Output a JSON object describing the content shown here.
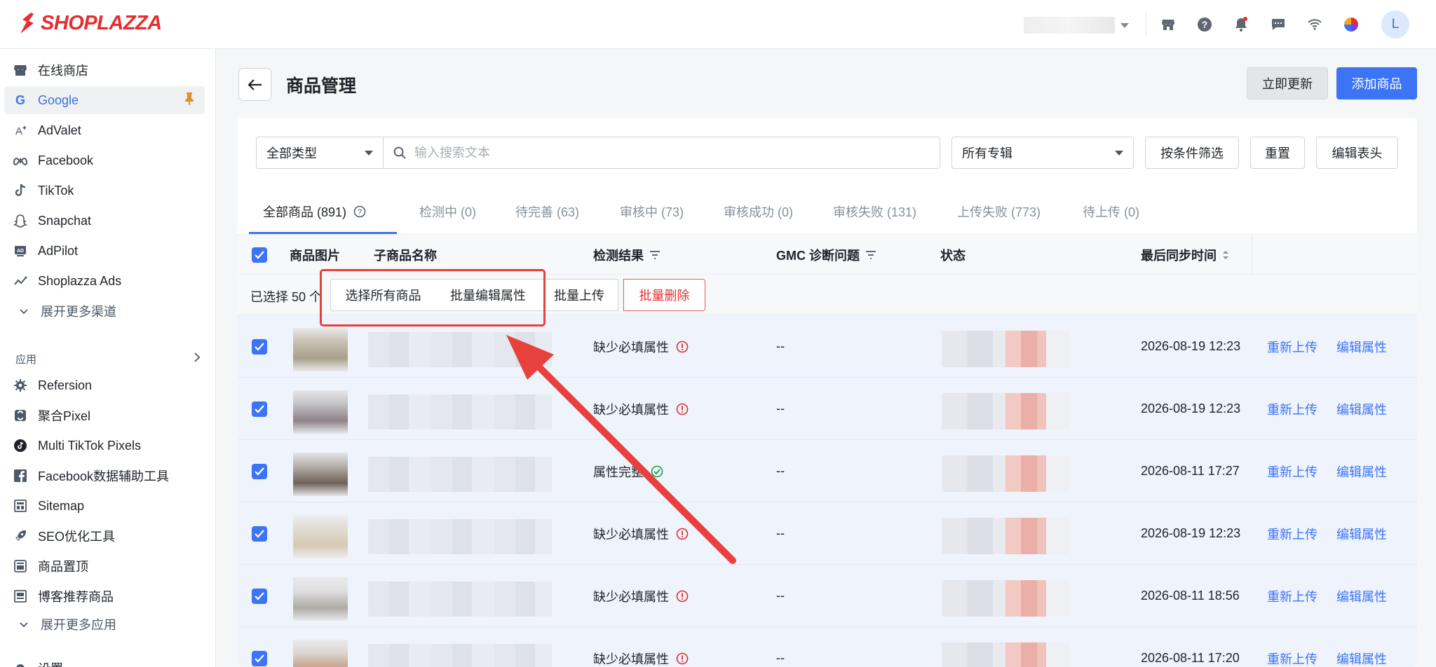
{
  "brand": {
    "name": "SHOPLAZZA",
    "color": "#e62d2f"
  },
  "topbar": {
    "icons": [
      "store-icon",
      "help-icon",
      "bell-icon",
      "chat-icon",
      "wifi-icon",
      "color-wheel-icon"
    ],
    "avatar_letter": "L"
  },
  "sidebar": {
    "channels": [
      {
        "label": "在线商店",
        "icon": "store-icon"
      },
      {
        "label": "Google",
        "icon": "google-icon",
        "active": true,
        "pinned": true
      },
      {
        "label": "AdValet",
        "icon": "advalet-icon"
      },
      {
        "label": "Facebook",
        "icon": "meta-icon"
      },
      {
        "label": "TikTok",
        "icon": "tiktok-icon"
      },
      {
        "label": "Snapchat",
        "icon": "snapchat-icon"
      },
      {
        "label": "AdPilot",
        "icon": "adpilot-icon"
      },
      {
        "label": "Shoplazza Ads",
        "icon": "shoplazza-ads-icon"
      }
    ],
    "expand_channels": "展开更多渠道",
    "apps_section": "应用",
    "apps": [
      {
        "label": "Refersion",
        "icon": "refersion-icon"
      },
      {
        "label": "聚合Pixel",
        "icon": "pixel-icon"
      },
      {
        "label": "Multi TikTok Pixels",
        "icon": "tiktok-icon"
      },
      {
        "label": "Facebook数据辅助工具",
        "icon": "facebook-icon"
      },
      {
        "label": "Sitemap",
        "icon": "sitemap-icon"
      },
      {
        "label": "SEO优化工具",
        "icon": "rocket-icon"
      },
      {
        "label": "商品置顶",
        "icon": "pin-top-icon"
      },
      {
        "label": "博客推荐商品",
        "icon": "blog-icon"
      }
    ],
    "expand_apps": "展开更多应用",
    "settings": "设置"
  },
  "header": {
    "title": "商品管理",
    "update_button": "立即更新",
    "add_button": "添加商品"
  },
  "filters": {
    "type_select": "全部类型",
    "search_placeholder": "输入搜索文本",
    "collection_select": "所有专辑",
    "condition_button": "按条件筛选",
    "reset_button": "重置",
    "edit_header_button": "编辑表头"
  },
  "tabs": [
    {
      "label": "全部商品 (891)",
      "active": true
    },
    {
      "label": "检测中 (0)"
    },
    {
      "label": "待完善 (63)"
    },
    {
      "label": "审核中 (73)"
    },
    {
      "label": "审核成功 (0)"
    },
    {
      "label": "审核失败 (131)"
    },
    {
      "label": "上传失败 (773)"
    },
    {
      "label": "待上传 (0)"
    }
  ],
  "table": {
    "columns": {
      "image": "商品图片",
      "name": "子商品名称",
      "result": "检测结果",
      "gmc": "GMC 诊断问题",
      "status": "状态",
      "last_sync": "最后同步时间"
    },
    "bulk": {
      "selected_label": "已选择 50 个",
      "select_all": "选择所有商品",
      "batch_edit": "批量编辑属性",
      "batch_upload": "批量上传",
      "batch_delete": "批量删除"
    },
    "rows": [
      {
        "result": "缺少必填属性",
        "result_type": "error",
        "gmc": "--",
        "last_sync": "2026-08-19 12:23",
        "action1": "重新上传",
        "action2": "编辑属性"
      },
      {
        "result": "缺少必填属性",
        "result_type": "error",
        "gmc": "--",
        "last_sync": "2026-08-19 12:23",
        "action1": "重新上传",
        "action2": "编辑属性"
      },
      {
        "result": "属性完整",
        "result_type": "ok",
        "gmc": "--",
        "last_sync": "2026-08-11 17:27",
        "action1": "重新上传",
        "action2": "编辑属性"
      },
      {
        "result": "缺少必填属性",
        "result_type": "error",
        "gmc": "--",
        "last_sync": "2026-08-19 12:23",
        "action1": "重新上传",
        "action2": "编辑属性"
      },
      {
        "result": "缺少必填属性",
        "result_type": "error",
        "gmc": "--",
        "last_sync": "2026-08-11 18:56",
        "action1": "重新上传",
        "action2": "编辑属性"
      },
      {
        "result": "缺少必填属性",
        "result_type": "error",
        "gmc": "--",
        "last_sync": "2026-08-11 17:20",
        "action1": "重新上传",
        "action2": "编辑属性"
      }
    ]
  },
  "colors": {
    "accent": "#3d74f5",
    "danger": "#e02f2f",
    "success": "#17a34a",
    "annotation": "#e8403a"
  }
}
